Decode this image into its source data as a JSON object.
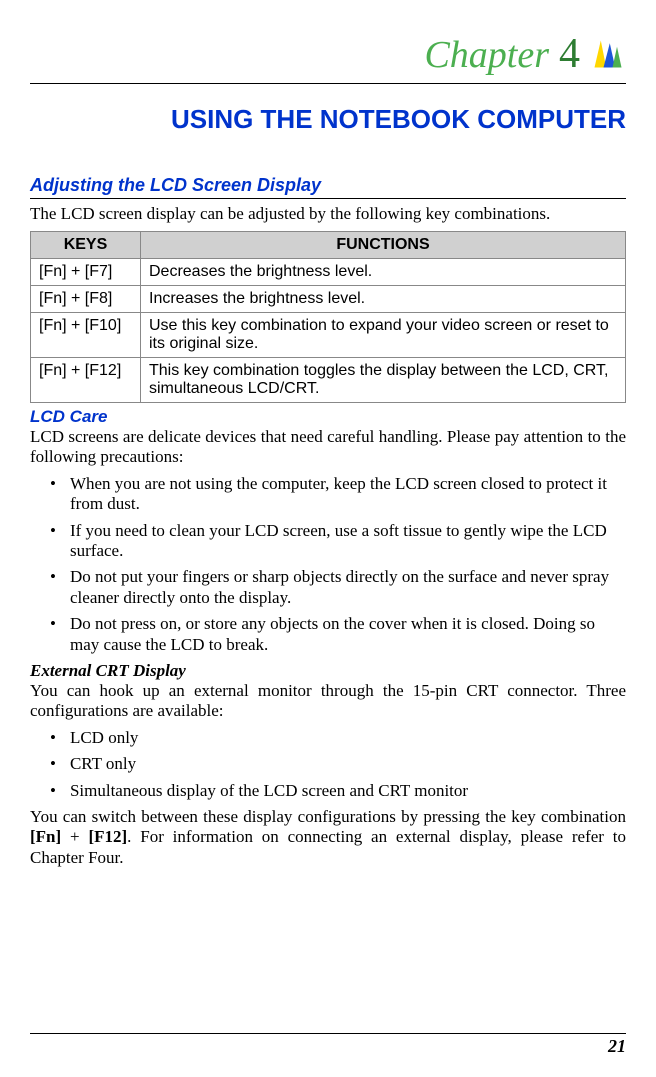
{
  "chapter": {
    "label": "Chapter",
    "number": "4"
  },
  "main_title": "USING THE NOTEBOOK COMPUTER",
  "section1": {
    "title": "Adjusting the LCD Screen Display",
    "intro": "The LCD screen display can be adjusted by the following key combinations."
  },
  "table": {
    "headers": {
      "keys": "KEYS",
      "functions": "FUNCTIONS"
    },
    "rows": [
      {
        "key": "[Fn] + [F7]",
        "func": "Decreases the brightness level."
      },
      {
        "key": "[Fn] + [F8]",
        "func": "Increases the brightness level."
      },
      {
        "key": "[Fn] + [F10]",
        "func": "Use this key combination to expand your video screen or reset to its original size."
      },
      {
        "key": "[Fn] + [F12]",
        "func": "This key combination toggles the display between the LCD, CRT, simultaneous LCD/CRT."
      }
    ]
  },
  "section2": {
    "title": "LCD Care",
    "intro": "LCD screens are delicate devices that need careful handling.  Please pay attention to the following precautions:",
    "bullets": [
      "When you are not using the computer, keep the LCD screen closed to protect it from dust.",
      "If you need to clean your LCD screen, use a soft tissue to gently wipe the LCD surface.",
      "Do not put your fingers or sharp objects directly on the surface and never spray cleaner directly onto the display.",
      "Do not press on, or store any objects on the cover when it is closed.  Doing so may cause the LCD to break."
    ]
  },
  "section3": {
    "title": "External CRT Display",
    "intro": "You can hook up an external monitor through the 15-pin CRT connector. Three configurations are available:",
    "bullets": [
      "LCD only",
      "CRT only",
      "Simultaneous display of the LCD screen and CRT monitor"
    ],
    "closing_prefix": "You can switch between these display configurations by pressing the key combination ",
    "closing_key1": "[Fn]",
    "closing_plus": " + ",
    "closing_key2": "[F12]",
    "closing_suffix": ".  For information on connecting an external display, please refer to Chapter Four."
  },
  "page_number": "21"
}
